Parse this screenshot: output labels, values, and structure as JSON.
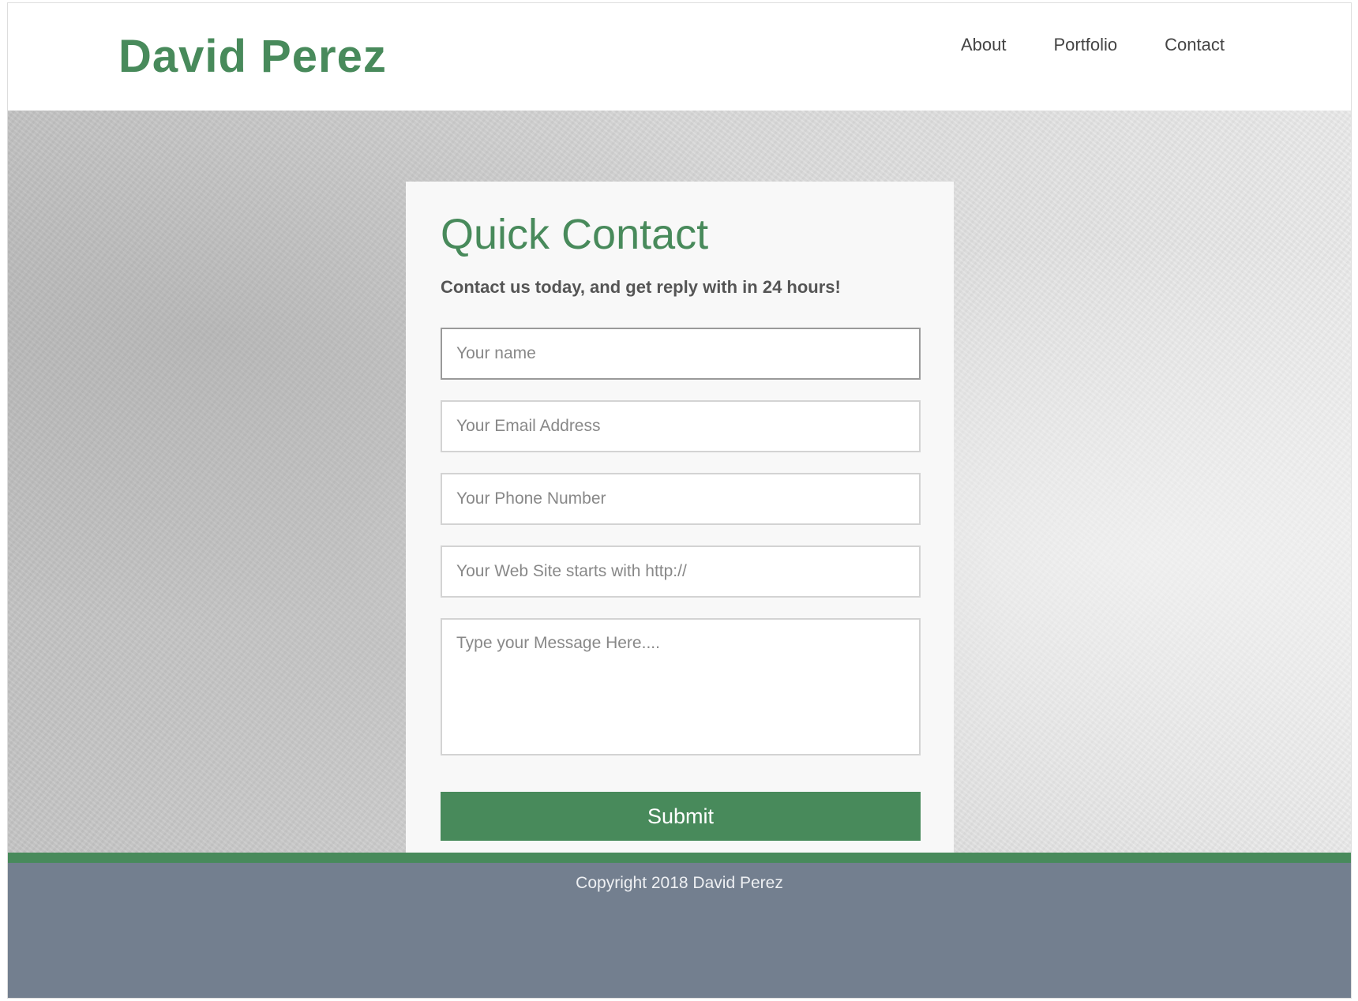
{
  "header": {
    "brand": "David Perez",
    "nav": [
      {
        "label": "About"
      },
      {
        "label": "Portfolio"
      },
      {
        "label": "Contact"
      }
    ]
  },
  "contact_form": {
    "title": "Quick Contact",
    "subtitle": "Contact us today, and get reply with in 24 hours!",
    "fields": {
      "name": {
        "value": "",
        "placeholder": "Your name"
      },
      "email": {
        "value": "",
        "placeholder": "Your Email Address"
      },
      "phone": {
        "value": "",
        "placeholder": "Your Phone Number"
      },
      "website": {
        "value": "",
        "placeholder": "Your Web Site starts with http://"
      },
      "message": {
        "value": "",
        "placeholder": "Type your Message Here...."
      }
    },
    "submit_label": "Submit"
  },
  "footer": {
    "copyright": "Copyright 2018 David Perez"
  },
  "colors": {
    "accent": "#488a5b",
    "footer_bg": "#737f8f",
    "card_bg": "#f8f8f8"
  }
}
